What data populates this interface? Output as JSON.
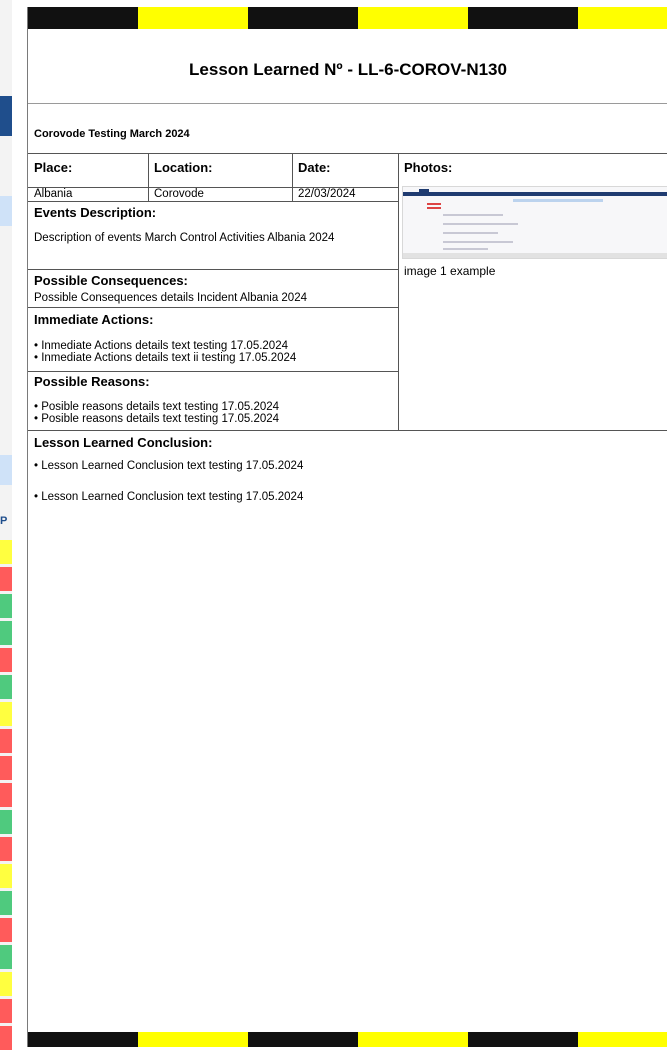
{
  "document": {
    "title": "Lesson Learned Nº - LL-6-COROV-N130",
    "subtitle": "Corovode Testing March 2024",
    "place_label": "Place:",
    "place_value": "Albania",
    "location_label": "Location:",
    "location_value": "Corovode",
    "date_label": "Date:",
    "date_value": "22/03/2024",
    "photos_label": "Photos:",
    "photo_caption": "image 1 example",
    "events_label": "Events Description:",
    "events_text": "Description of events March Control Activities Albania 2024",
    "consequences_label": "Possible Consequences:",
    "consequences_text": "Possible Consequences details Incident Albania 2024",
    "actions_label": "Immediate Actions:",
    "actions_items": [
      "• Inmediate Actions details text testing 17.05.2024",
      "• Inmediate Actions details text ii testing 17.05.2024"
    ],
    "reasons_label": "Possible Reasons:",
    "reasons_items": [
      "• Posible reasons details text testing 17.05.2024",
      "• Posible reasons details text testing 17.05.2024"
    ],
    "conclusion_label": "Lesson Learned Conclusion:",
    "conclusion_items": [
      "• Lesson Learned Conclusion text testing 17.05.2024",
      "• Lesson Learned Conclusion text testing 17.05.2024"
    ]
  },
  "background_app": {
    "column_letter": "P"
  },
  "colors": {
    "stripe_black": "#111111",
    "stripe_yellow": "#ffff00",
    "status_red": "#ff5b5b",
    "status_green": "#4fca7e",
    "status_yellow": "#ffff40",
    "app_blue": "#1f4e8c",
    "app_light_blue": "#cfe2f8"
  }
}
